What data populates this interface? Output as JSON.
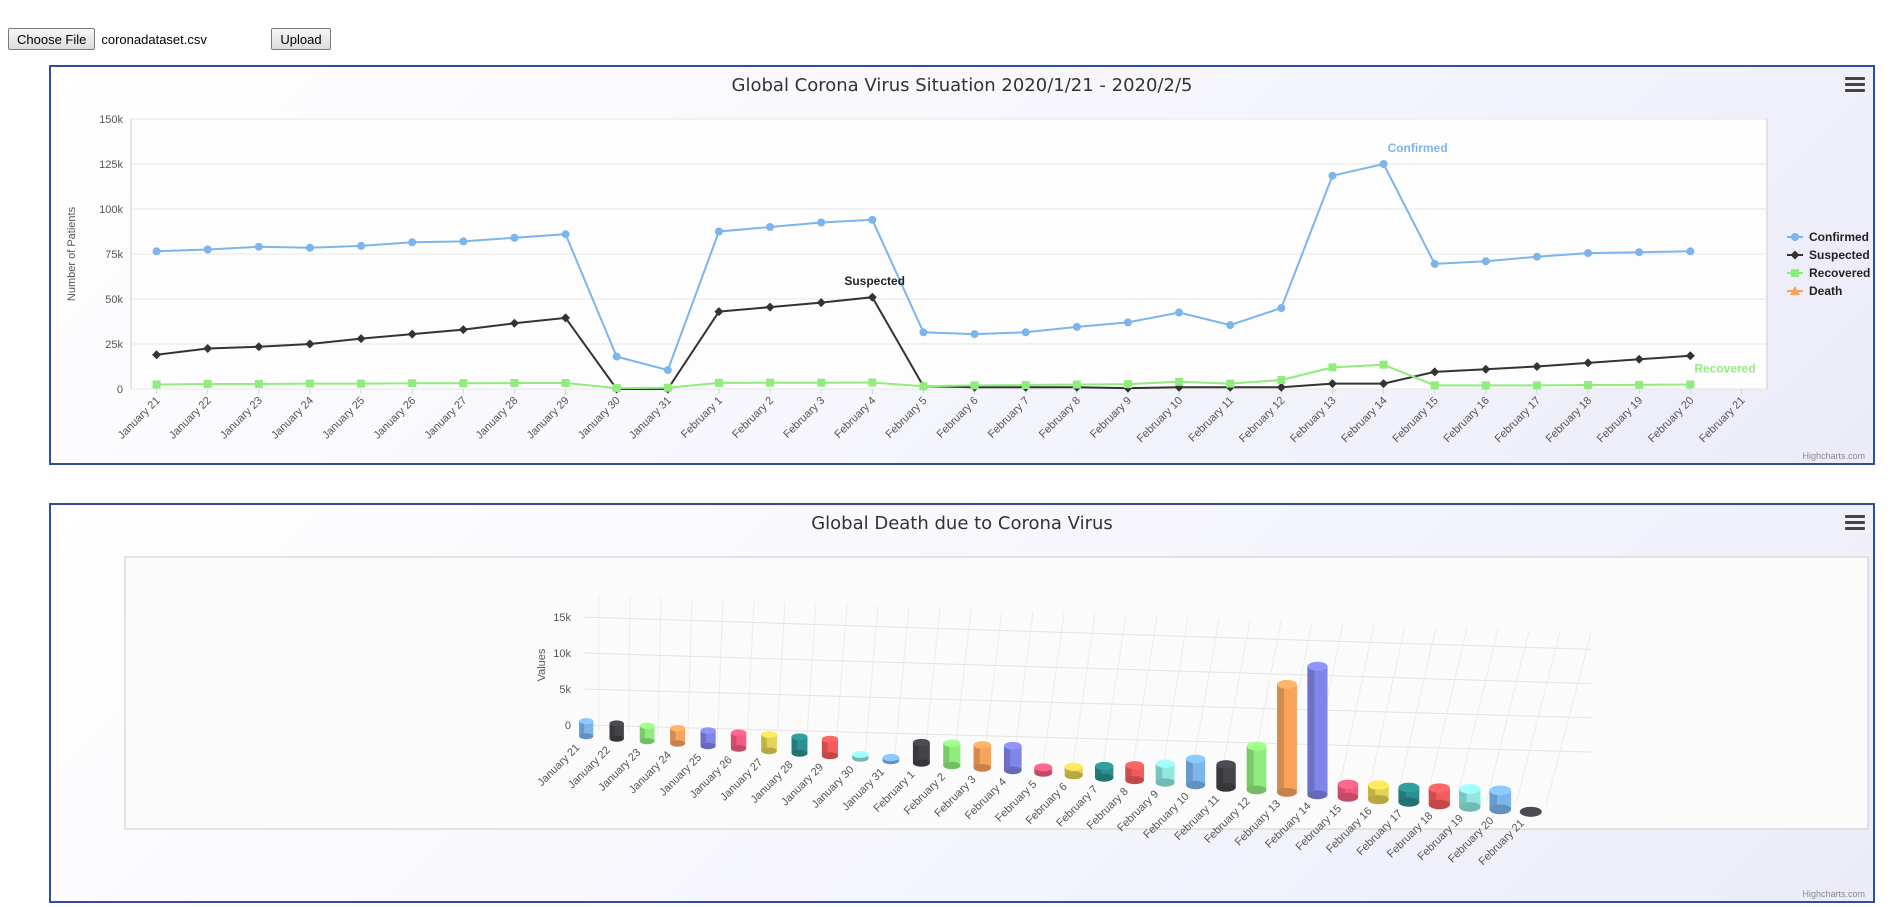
{
  "upload": {
    "choose_label": "Choose File",
    "file_name": "coronadataset.csv",
    "upload_label": "Upload"
  },
  "credits": "Highcharts.com",
  "chart_data": [
    {
      "type": "line",
      "title": "Global Corona Virus Situation 2020/1/21 - 2020/2/5",
      "xlabel": "",
      "ylabel": "Number of Patients",
      "ylim": [
        0,
        150000
      ],
      "yticks": [
        "0",
        "25k",
        "50k",
        "75k",
        "100k",
        "125k",
        "150k"
      ],
      "grid": true,
      "legend_position": "right",
      "categories": [
        "January 21",
        "January 22",
        "January 23",
        "January 24",
        "January 25",
        "January 26",
        "January 27",
        "January 28",
        "January 29",
        "January 30",
        "January 31",
        "February 1",
        "February 2",
        "February 3",
        "February 4",
        "February 5",
        "February 6",
        "February 7",
        "February 8",
        "February 9",
        "February 10",
        "February 11",
        "February 12",
        "February 13",
        "February 14",
        "February 15",
        "February 16",
        "February 17",
        "February 18",
        "February 19",
        "February 20",
        "February 21"
      ],
      "series": [
        {
          "name": "Confirmed",
          "color": "#7cb5ec",
          "marker": "circle",
          "label": "Confirmed",
          "label_index": 24,
          "values": [
            76500,
            77500,
            79000,
            78500,
            79500,
            81500,
            82000,
            84000,
            86000,
            18000,
            10500,
            87500,
            90000,
            92500,
            94000,
            31500,
            30500,
            31500,
            34500,
            37000,
            42500,
            35500,
            45000,
            118500,
            125000,
            69500,
            71000,
            73500,
            75500,
            76000,
            76500
          ]
        },
        {
          "name": "Suspected",
          "color": "#333333",
          "marker": "diamond",
          "label": "Suspected",
          "label_index": 14,
          "values": [
            19000,
            22500,
            23500,
            25000,
            28000,
            30500,
            33000,
            36500,
            39500,
            0,
            0,
            43000,
            45500,
            48000,
            51000,
            1500,
            1000,
            1000,
            1000,
            500,
            1000,
            1000,
            1000,
            3000,
            3000,
            9500,
            11000,
            12500,
            14500,
            16500,
            18500
          ]
        },
        {
          "name": "Recovered",
          "color": "#90ed7d",
          "marker": "square",
          "label": "Recovered",
          "label_index": 30,
          "values": [
            2500,
            2800,
            2800,
            3000,
            3000,
            3200,
            3200,
            3300,
            3300,
            500,
            700,
            3400,
            3500,
            3500,
            3600,
            1500,
            2000,
            2200,
            2500,
            2700,
            4000,
            3000,
            5000,
            12000,
            13500,
            2000,
            2000,
            2000,
            2200,
            2300,
            2500
          ]
        },
        {
          "name": "Death",
          "color": "#f7a35c",
          "marker": "triangle",
          "values": []
        }
      ]
    },
    {
      "type": "bar",
      "title": "Global Death due to Corona Virus",
      "xlabel": "",
      "ylabel": "Values",
      "ylim": [
        0,
        15000
      ],
      "yticks": [
        "0",
        "5k",
        "10k",
        "15k"
      ],
      "grid": true,
      "categories": [
        "January 21",
        "January 22",
        "January 23",
        "January 24",
        "January 25",
        "January 26",
        "January 27",
        "January 28",
        "January 29",
        "January 30",
        "January 31",
        "February 1",
        "February 2",
        "February 3",
        "February 4",
        "February 5",
        "February 6",
        "February 7",
        "February 8",
        "February 9",
        "February 10",
        "February 11",
        "February 12",
        "February 13",
        "February 14",
        "February 15",
        "February 16",
        "February 17",
        "February 18",
        "February 19",
        "February 20",
        "February 21"
      ],
      "values": [
        2100,
        2100,
        2100,
        2100,
        2100,
        2100,
        2200,
        2200,
        2200,
        500,
        400,
        2700,
        2900,
        3000,
        3200,
        700,
        1100,
        1500,
        1900,
        2400,
        3300,
        2900,
        5500,
        13500,
        16000,
        1600,
        1800,
        1800,
        2000,
        2200,
        2300,
        0
      ],
      "colors": [
        "#7cb5ec",
        "#434348",
        "#90ed7d",
        "#f7a35c",
        "#8085e9",
        "#f15c80",
        "#e4d354",
        "#2b908f",
        "#f45b5b",
        "#91e8e1"
      ]
    }
  ]
}
